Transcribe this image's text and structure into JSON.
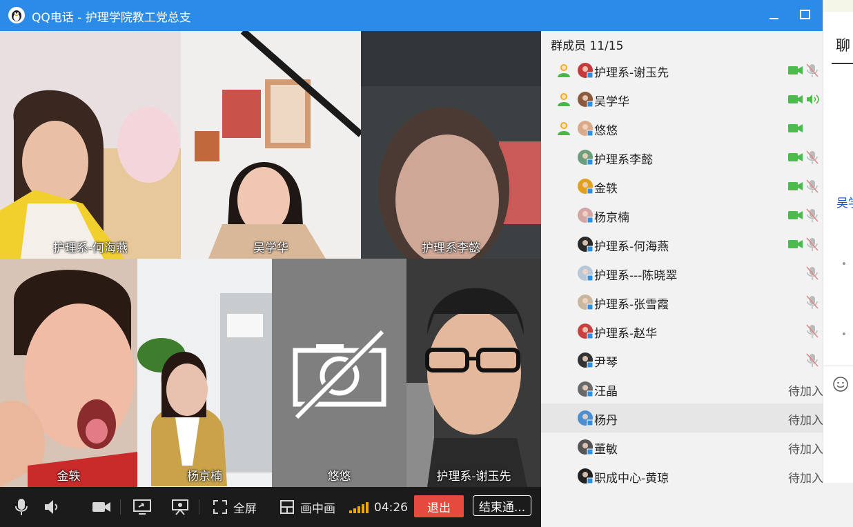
{
  "window": {
    "title": "QQ电话 - 护理学院教工党总支",
    "icons": {
      "logo": "qq-penguin-icon",
      "minimize": "minimize-icon",
      "maximize": "maximize-icon"
    }
  },
  "video_tiles": [
    {
      "name": "护理系-何海燕"
    },
    {
      "name": "吴学华"
    },
    {
      "name": "护理系李懿"
    },
    {
      "name": "金轶"
    },
    {
      "name": "杨京楠"
    },
    {
      "name": "悠悠",
      "camera_off": true
    },
    {
      "name": "护理系-谢玉先"
    }
  ],
  "controls": {
    "fullscreen_label": "全屏",
    "pip_label": "画中画",
    "timer": "04:26",
    "exit_label": "退出",
    "end_call_label": "结束通...",
    "icons": [
      "microphone-icon",
      "speaker-icon",
      "camera-icon",
      "screen-share-icon",
      "presentation-icon",
      "fullscreen-icon",
      "picture-in-picture-icon",
      "signal-icon"
    ]
  },
  "members": {
    "header": "群成员 11/15",
    "pending_label": "待加入",
    "list": [
      {
        "name": "护理系-谢玉先",
        "host": true,
        "camera": true,
        "mic": "muted"
      },
      {
        "name": "吴学华",
        "host": true,
        "camera": true,
        "mic": "speaking"
      },
      {
        "name": "悠悠",
        "host": true,
        "camera": true,
        "mic": "none"
      },
      {
        "name": "护理系李懿",
        "camera": true,
        "mic": "muted"
      },
      {
        "name": "金轶",
        "camera": true,
        "mic": "muted"
      },
      {
        "name": "杨京楠",
        "camera": true,
        "mic": "muted"
      },
      {
        "name": "护理系-何海燕",
        "camera": true,
        "mic": "muted"
      },
      {
        "name": "护理系---陈晓翠",
        "camera": false,
        "mic": "muted"
      },
      {
        "name": "护理系-张雪霞",
        "camera": false,
        "mic": "muted"
      },
      {
        "name": "护理系-赵华",
        "camera": false,
        "mic": "muted"
      },
      {
        "name": "尹琴",
        "camera": false,
        "mic": "muted"
      },
      {
        "name": "汪晶",
        "pending": true
      },
      {
        "name": "杨丹",
        "pending": true,
        "highlighted": true
      },
      {
        "name": "董敏",
        "pending": true
      },
      {
        "name": "职成中心-黄琼",
        "pending": true
      }
    ]
  },
  "chat": {
    "tab_label": "聊",
    "link_text": "吴学",
    "icons": {
      "emoji": "emoji-icon"
    }
  },
  "colors": {
    "titlebar": "#2b8be6",
    "exit_button": "#e64a3c",
    "camera_on": "#4cbb4c",
    "mic_muted": "#bbbbbb",
    "highlight_row": "#e6e6e6"
  }
}
